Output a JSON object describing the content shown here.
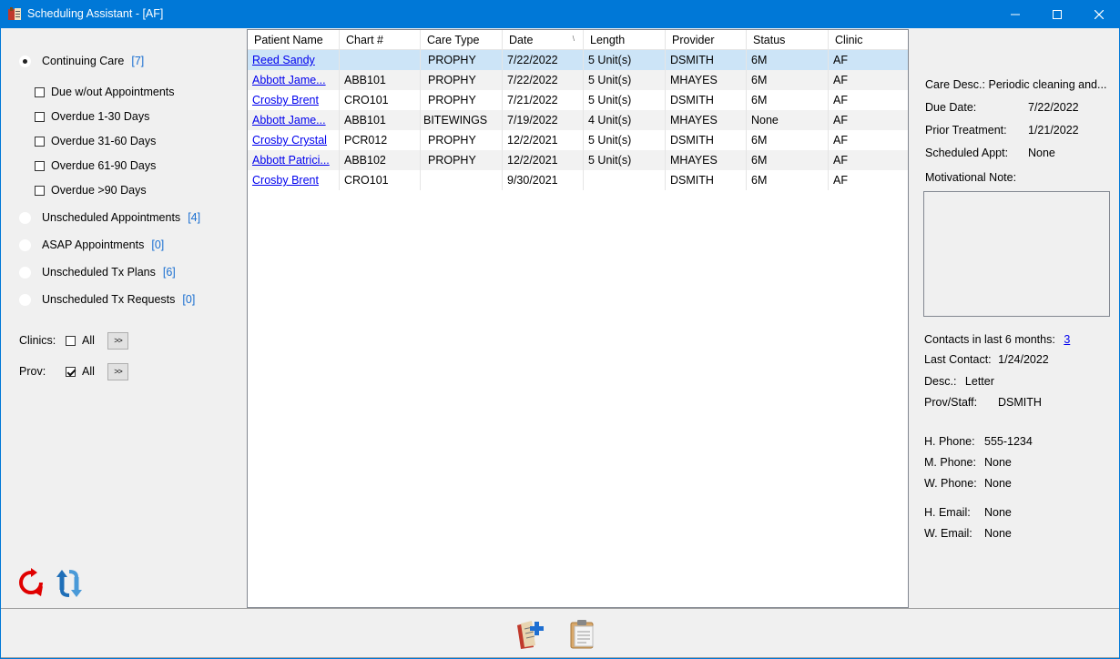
{
  "window": {
    "title": "Scheduling Assistant - [AF]"
  },
  "left": {
    "continuing_care": {
      "label": "Continuing Care",
      "count": "[7]",
      "selected": true
    },
    "filters": [
      {
        "label": "Due w/out Appointments",
        "checked": false
      },
      {
        "label": "Overdue 1-30 Days",
        "checked": false
      },
      {
        "label": "Overdue 31-60 Days",
        "checked": false
      },
      {
        "label": "Overdue 61-90 Days",
        "checked": false
      },
      {
        "label": "Overdue >90 Days",
        "checked": false
      }
    ],
    "options": [
      {
        "label": "Unscheduled Appointments",
        "count": "[4]"
      },
      {
        "label": "ASAP Appointments",
        "count": "[0]"
      },
      {
        "label": "Unscheduled Tx Plans",
        "count": "[6]"
      },
      {
        "label": "Unscheduled Tx Requests",
        "count": "[0]"
      }
    ],
    "clinics": {
      "label": "Clinics:",
      "all_label": "All",
      "all_checked": false,
      "more_label": ">>"
    },
    "prov": {
      "label": "Prov:",
      "all_label": "All",
      "all_checked": true,
      "more_label": ">>"
    }
  },
  "grid": {
    "columns": [
      "Patient Name",
      "Chart #",
      "Care Type",
      "Date",
      "Length",
      "Provider",
      "Status",
      "Clinic"
    ],
    "sort_indicator": "\\",
    "rows": [
      {
        "name": "Reed Sandy",
        "chart": "",
        "care": "PROPHY",
        "date": "7/22/2022",
        "length": "5 Unit(s)",
        "provider": "DSMITH",
        "status": "6M",
        "clinic": "AF"
      },
      {
        "name": "Abbott Jame...",
        "chart": "ABB101",
        "care": "PROPHY",
        "date": "7/22/2022",
        "length": "5 Unit(s)",
        "provider": "MHAYES",
        "status": "6M",
        "clinic": "AF"
      },
      {
        "name": "Crosby Brent",
        "chart": "CRO101",
        "care": "PROPHY",
        "date": "7/21/2022",
        "length": "5 Unit(s)",
        "provider": "DSMITH",
        "status": "6M",
        "clinic": "AF"
      },
      {
        "name": "Abbott Jame...",
        "chart": "ABB101",
        "care": "BITEWINGS",
        "date": "7/19/2022",
        "length": "4 Unit(s)",
        "provider": "MHAYES",
        "status": "None",
        "clinic": "AF"
      },
      {
        "name": "Crosby Crystal",
        "chart": "PCR012",
        "care": "PROPHY",
        "date": "12/2/2021",
        "length": "5 Unit(s)",
        "provider": "DSMITH",
        "status": "6M",
        "clinic": "AF"
      },
      {
        "name": "Abbott Patrici...",
        "chart": "ABB102",
        "care": "PROPHY",
        "date": "12/2/2021",
        "length": "5 Unit(s)",
        "provider": "MHAYES",
        "status": "6M",
        "clinic": "AF"
      },
      {
        "name": "Crosby Brent",
        "chart": "CRO101",
        "care": "",
        "date": "9/30/2021",
        "length": "",
        "provider": "DSMITH",
        "status": "6M",
        "clinic": "AF"
      }
    ]
  },
  "details": {
    "care_desc_label": "Care Desc.:",
    "care_desc_value": "Periodic cleaning and...",
    "due_date_label": "Due Date:",
    "due_date_value": "7/22/2022",
    "prior_treatment_label": "Prior Treatment:",
    "prior_treatment_value": "1/21/2022",
    "scheduled_appt_label": "Scheduled Appt:",
    "scheduled_appt_value": "None",
    "motivational_note_label": "Motivational Note:",
    "motivational_note_value": "",
    "contacts_label": "Contacts in last 6 months:",
    "contacts_value": "3",
    "last_contact_label": "Last Contact:",
    "last_contact_value": "1/24/2022",
    "desc_label": "Desc.:",
    "desc_value": "Letter",
    "prov_staff_label": "Prov/Staff:",
    "prov_staff_value": "DSMITH",
    "h_phone_label": "H. Phone:",
    "h_phone_value": "555-1234",
    "m_phone_label": "M. Phone:",
    "m_phone_value": "None",
    "w_phone_label": "W. Phone:",
    "w_phone_value": "None",
    "h_email_label": "H. Email:",
    "h_email_value": "None",
    "w_email_label": "W. Email:",
    "w_email_value": "None"
  },
  "icons": {
    "app": "scheduling-book-icon",
    "refresh": "refresh-icon",
    "sync": "sync-icon",
    "schedule": "schedule-appointment-icon",
    "clipboard": "clipboard-icon"
  },
  "colors": {
    "titlebar": "#0078d7",
    "selection": "#cce4f7",
    "count": "#1a6fd1",
    "link": "#0000ee"
  }
}
